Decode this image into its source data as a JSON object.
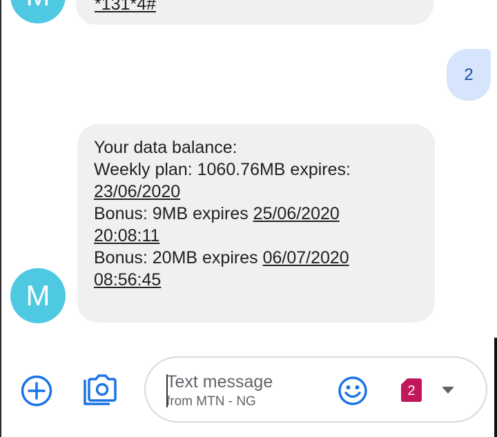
{
  "conversation": {
    "avatar_initial": "M",
    "top_message": "*131*4#",
    "sent_message": "2",
    "received_message": {
      "lines": [
        {
          "text": "Your data balance:"
        },
        {
          "text": "Weekly plan: 1060.76MB expires:"
        },
        {
          "text": "23/06/2020"
        },
        {
          "pre": "Bonus: 9MB expires ",
          "link": "25/06/2020"
        },
        {
          "text": "20:08:11"
        },
        {
          "pre": "Bonus: 20MB expires ",
          "link": "06/07/2020"
        },
        {
          "text": "08:56:45"
        }
      ]
    }
  },
  "composer": {
    "placeholder": "Text message",
    "subtitle": "from MTN - NG",
    "sim_badge": "2"
  },
  "icons": {
    "add": "plus-circle-icon",
    "camera": "camera-icon",
    "emoji": "smiley-icon",
    "sim": "sim-card-icon",
    "dropdown": "caret-down-icon"
  },
  "colors": {
    "avatar": "#4ec9e1",
    "incoming_bubble": "#f0f0f0",
    "outgoing_bubble": "#d6e5fb",
    "accent_blue": "#1a73e8",
    "sim_red": "#c2185b"
  }
}
